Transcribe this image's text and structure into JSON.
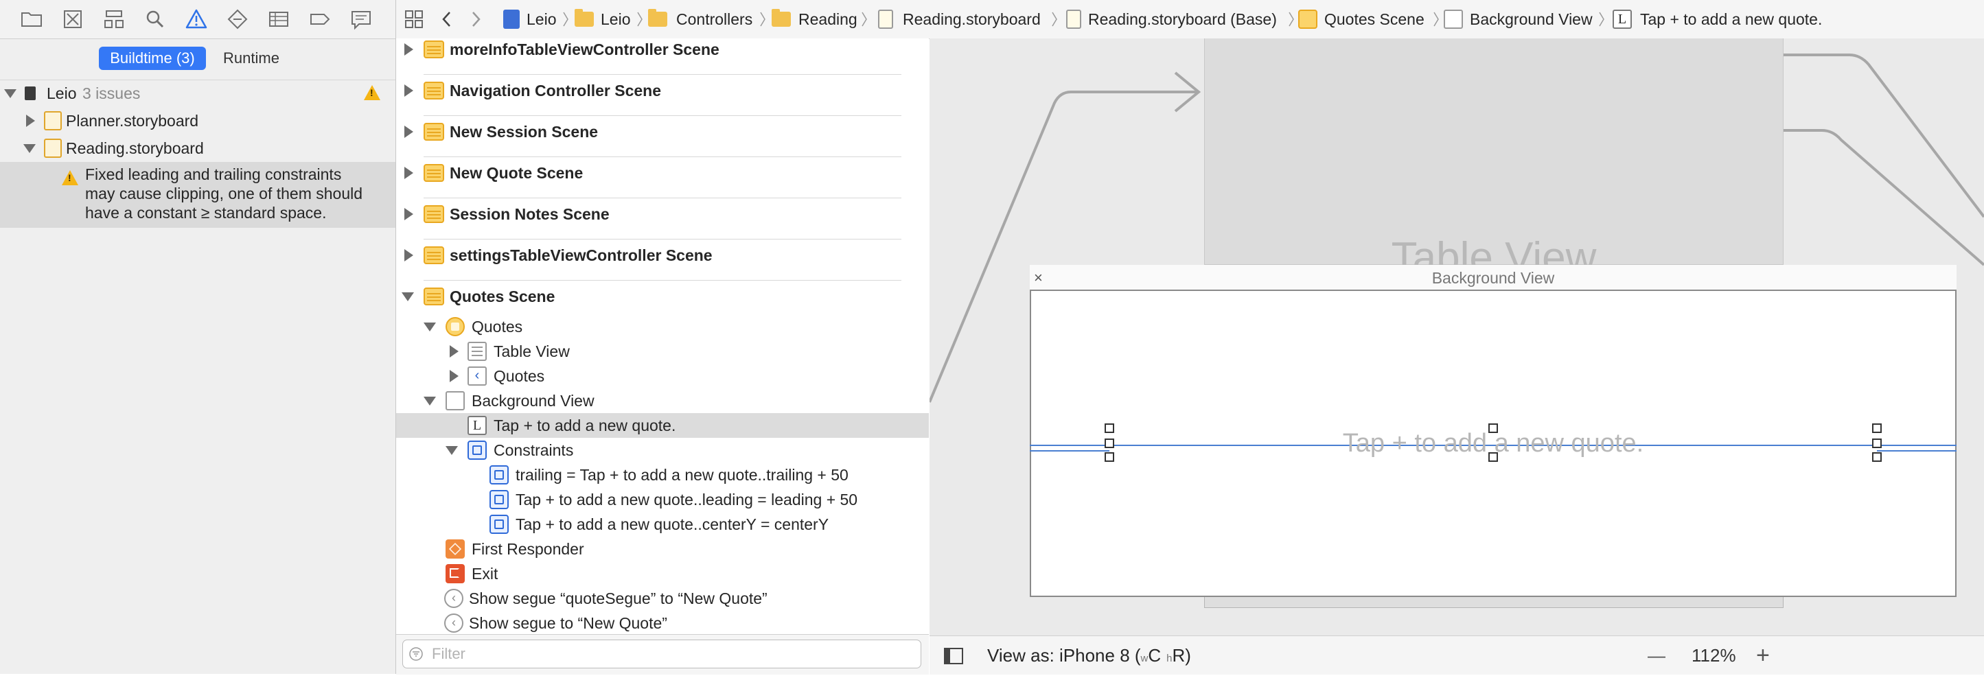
{
  "navigator": {
    "toolbar_icons": [
      "folder-icon",
      "source-control-icon",
      "hierarchy-icon",
      "find-icon",
      "issue-warning-icon",
      "test-icon",
      "debug-icon",
      "breakpoint-icon",
      "report-icon"
    ],
    "segments": [
      {
        "label": "Buildtime (3)",
        "selected": true
      },
      {
        "label": "Runtime",
        "selected": false
      }
    ],
    "project": {
      "name": "Leio",
      "issue_count": "3 issues"
    },
    "files": [
      {
        "name": "Planner.storyboard",
        "expanded": false
      },
      {
        "name": "Reading.storyboard",
        "expanded": true
      }
    ],
    "issue_message": [
      "Fixed leading and trailing constraints",
      "may cause clipping, one of them should",
      "have a constant ≥ standard space."
    ]
  },
  "jumpbar": {
    "path": [
      "Leio",
      "Leio",
      "Controllers",
      "Reading",
      "Reading.storyboard",
      "Reading.storyboard (Base)",
      "Quotes Scene",
      "Background View",
      "Tap + to add a new quote."
    ]
  },
  "outline": {
    "scenes": [
      "moreInfoTableViewController Scene",
      "Navigation Controller Scene",
      "New Session Scene",
      "New Quote Scene",
      "Session Notes Scene",
      "settingsTableViewController Scene",
      "Quotes Scene"
    ],
    "quotes_vc": "Quotes",
    "table_view": "Table View",
    "nav_item": "Quotes",
    "background_view": "Background View",
    "label_item": "Tap + to add a new quote.",
    "constraints": "Constraints",
    "constraint_items": [
      "trailing = Tap + to add a new quote..trailing + 50",
      "Tap + to add a new quote..leading = leading + 50",
      "Tap + to add a new quote..centerY = centerY"
    ],
    "first_responder": "First Responder",
    "exit": "Exit",
    "segues": [
      "Show segue “quoteSegue” to “New Quote”",
      "Show segue to “New Quote”"
    ],
    "filter_placeholder": "Filter"
  },
  "canvas": {
    "tableview_label": "Table View",
    "bgview_title": "Background View",
    "close_glyph": "×",
    "quote_label": "Tap + to add a new quote."
  },
  "bottom_bar": {
    "view_as_prefix": "View as: iPhone 8 (",
    "w": "w",
    "C": "C",
    "h": "h",
    "R": "R",
    "view_as_suffix": ")",
    "zoom_minus": "—",
    "zoom": "112%",
    "zoom_plus": "+"
  },
  "colors": {
    "accent": "#3478f6",
    "warning": "#f5b515",
    "constraint": "#4a7fd1"
  }
}
